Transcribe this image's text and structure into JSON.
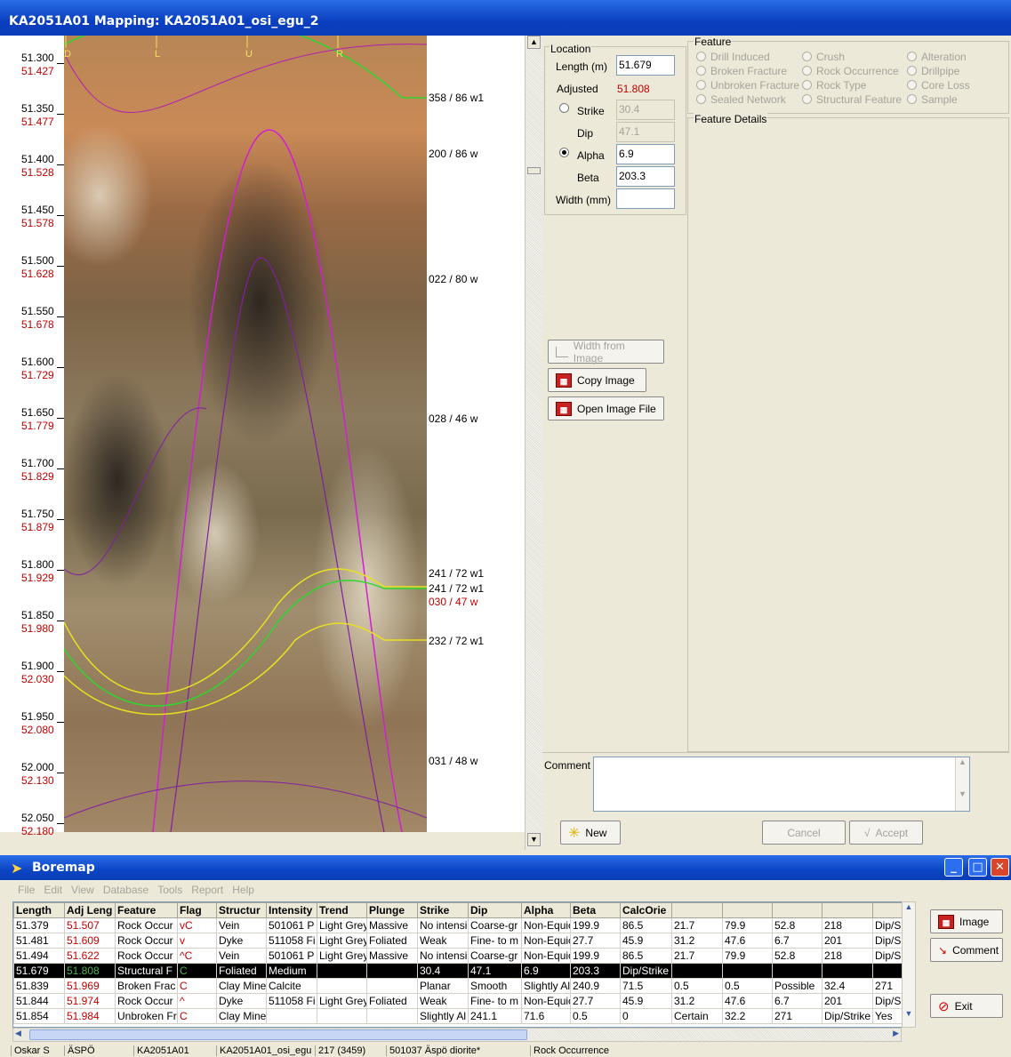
{
  "window": {
    "title": "KA2051A01 Mapping: KA2051A01_osi_egu_2"
  },
  "core": {
    "orientation_labels": [
      "D",
      "L",
      "U",
      "R"
    ],
    "depths": [
      {
        "length": "51.300",
        "adjusted": "51.427"
      },
      {
        "length": "51.350",
        "adjusted": "51.477"
      },
      {
        "length": "51.400",
        "adjusted": "51.528"
      },
      {
        "length": "51.450",
        "adjusted": "51.578"
      },
      {
        "length": "51.500",
        "adjusted": "51.628"
      },
      {
        "length": "51.550",
        "adjusted": "51.678"
      },
      {
        "length": "51.600",
        "adjusted": "51.729"
      },
      {
        "length": "51.650",
        "adjusted": "51.779"
      },
      {
        "length": "51.700",
        "adjusted": "51.829"
      },
      {
        "length": "51.750",
        "adjusted": "51.879"
      },
      {
        "length": "51.800",
        "adjusted": "51.929"
      },
      {
        "length": "51.850",
        "adjusted": "51.980"
      },
      {
        "length": "51.900",
        "adjusted": "52.030"
      },
      {
        "length": "51.950",
        "adjusted": "52.080"
      },
      {
        "length": "52.000",
        "adjusted": "52.130"
      },
      {
        "length": "52.050",
        "adjusted": "52.180"
      }
    ],
    "annotations": [
      {
        "text": "358 / 86 w1",
        "color": "#000000"
      },
      {
        "text": "200 / 86 w",
        "color": "#000000"
      },
      {
        "text": "022 / 80 w",
        "color": "#000000"
      },
      {
        "text": "028 / 46 w",
        "color": "#000000"
      },
      {
        "text": "241 / 72 w1",
        "color": "#000000"
      },
      {
        "text": "241 / 72 w1",
        "color": "#000000"
      },
      {
        "text": "030 / 47 w",
        "color": "#c00000"
      },
      {
        "text": "232 / 72 w1",
        "color": "#000000"
      },
      {
        "text": "031 / 48 w",
        "color": "#000000"
      }
    ]
  },
  "location": {
    "group_label": "Location",
    "length_label": "Length (m)",
    "length_value": "51.679",
    "adjusted_label": "Adjusted",
    "adjusted_value": "51.808",
    "strike_label": "Strike",
    "strike_value": "30.4",
    "dip_label": "Dip",
    "dip_value": "47.1",
    "alpha_label": "Alpha",
    "alpha_value": "6.9",
    "beta_label": "Beta",
    "beta_value": "203.3",
    "width_label": "Width (mm)",
    "width_value": ""
  },
  "buttons": {
    "width_from_image": "Width from Image",
    "copy_image": "Copy Image",
    "open_image_file": "Open Image File",
    "new": "New",
    "cancel": "Cancel",
    "accept": "Accept"
  },
  "feature": {
    "group_label": "Feature",
    "options": [
      "Drill Induced",
      "Crush",
      "Alteration",
      "Broken Fracture",
      "Rock Occurrence",
      "Drillpipe",
      "Unbroken Fracture",
      "Rock Type",
      "Core Loss",
      "Sealed Network",
      "Structural Feature",
      "Sample"
    ],
    "details_label": "Feature Details"
  },
  "comment": {
    "label": "Comment",
    "value": ""
  },
  "boremap": {
    "title": "Boremap",
    "menu": [
      "File",
      "Edit",
      "View",
      "Database",
      "Tools",
      "Report",
      "Help"
    ],
    "columns": [
      "Length",
      "Adj Leng",
      "Feature",
      "Flag",
      "Structur",
      "Intensity",
      "Trend",
      "Plunge",
      "Strike",
      "Dip",
      "Alpha",
      "Beta",
      "CalcOrie",
      "",
      "",
      "",
      "",
      ""
    ],
    "rows": [
      [
        "51.379",
        "51.507",
        "Rock Occur",
        "vC",
        "Vein",
        "501061 P",
        "Light Grey",
        "Massive",
        "No intensi",
        "Coarse-gr",
        "Non-Equic",
        "199.9",
        "86.5",
        "21.7",
        "79.9",
        "52.8",
        "218",
        "Dip/S"
      ],
      [
        "51.481",
        "51.609",
        "Rock Occur",
        "v",
        "Dyke",
        "511058 Fi",
        "Light Grey",
        "Foliated",
        "Weak",
        "Fine- to m",
        "Non-Equic",
        "27.7",
        "45.9",
        "31.2",
        "47.6",
        "6.7",
        "201",
        "Dip/S"
      ],
      [
        "51.494",
        "51.622",
        "Rock Occur",
        "^C",
        "Vein",
        "501061 P",
        "Light Grey",
        "Massive",
        "No intensi",
        "Coarse-gr",
        "Non-Equic",
        "199.9",
        "86.5",
        "21.7",
        "79.9",
        "52.8",
        "218",
        "Dip/S"
      ],
      [
        "51.679",
        "51.808",
        "Structural F",
        "C",
        "Foliated",
        "Medium",
        "",
        "",
        "30.4",
        "47.1",
        "6.9",
        "203.3",
        "Dip/Strike",
        "",
        "",
        "",
        "",
        ""
      ],
      [
        "51.839",
        "51.969",
        "Broken Frac",
        "C",
        "Clay Mine",
        "Calcite",
        "",
        "",
        "Planar",
        "Smooth",
        "Slightly Al",
        "240.9",
        "71.5",
        "0.5",
        "0.5",
        "Possible",
        "32.4",
        "271"
      ],
      [
        "51.844",
        "51.974",
        "Rock Occur",
        "^",
        "Dyke",
        "511058 Fi",
        "Light Grey",
        "Foliated",
        "Weak",
        "Fine- to m",
        "Non-Equic",
        "27.7",
        "45.9",
        "31.2",
        "47.6",
        "6.7",
        "201",
        "Dip/S"
      ],
      [
        "51.854",
        "51.984",
        "Unbroken Fr",
        "C",
        "Clay Mine",
        "",
        "",
        "",
        "Slightly Al",
        "241.1",
        "71.6",
        "0.5",
        "0",
        "Certain",
        "32.2",
        "271",
        "Dip/Strike",
        "Yes"
      ]
    ],
    "selected_row": 3,
    "side_buttons": {
      "image": "Image",
      "comment": "Comment",
      "exit": "Exit"
    },
    "status": [
      "Oskar S",
      "ÄSPÖ",
      "KA2051A01",
      "KA2051A01_osi_egu",
      "217 (3459)",
      "501037 Äspö diorite*",
      "Rock Occurrence"
    ]
  }
}
